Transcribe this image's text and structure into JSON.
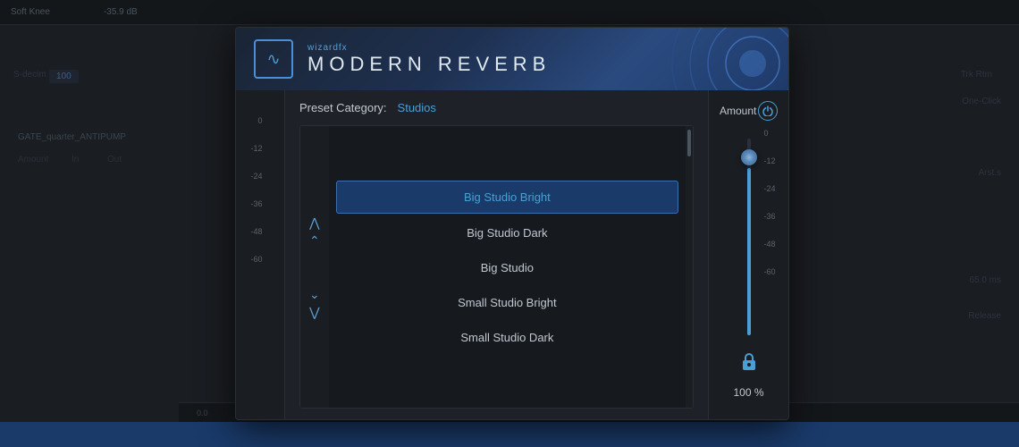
{
  "header": {
    "brand": "wizardFX",
    "product": "MODERN  REVERB",
    "logo_symbol": "∿"
  },
  "preset": {
    "category_label": "Preset Category:",
    "category_value": "Studios"
  },
  "preset_list": {
    "items": [
      {
        "id": "big-studio-bright",
        "label": "Big Studio Bright",
        "selected": true
      },
      {
        "id": "big-studio-dark",
        "label": "Big Studio Dark",
        "selected": false
      },
      {
        "id": "big-studio",
        "label": "Big Studio",
        "selected": false
      },
      {
        "id": "small-studio-bright",
        "label": "Small Studio Bright",
        "selected": false
      },
      {
        "id": "small-studio-dark",
        "label": "Small Studio Dark",
        "selected": false
      }
    ]
  },
  "amount": {
    "label": "Amount",
    "value": "100 %",
    "slider_position_pct": 15
  },
  "vu_scale": {
    "left_ticks": [
      "0",
      "-12",
      "-24",
      "-36",
      "-48",
      "-60"
    ],
    "right_ticks": [
      "0",
      "-12",
      "-24",
      "-36",
      "-48",
      "-60"
    ]
  },
  "nav_buttons": {
    "up_double": "«",
    "up_single": "‹",
    "down_single": "›",
    "down_double": "»"
  },
  "bg_labels": {
    "soft_knee": "Soft Knee",
    "gate_preset": "GATE_quarter_ANTIPUMP",
    "amount_label": "Amount",
    "in_label": "In",
    "out_label": "Out"
  },
  "colors": {
    "accent_blue": "#4a9fd4",
    "dark_bg": "#1e2228",
    "panel_bg": "#1a1d22",
    "selected_bg": "#1a3a6a",
    "selected_border": "#3a70b0",
    "text_primary": "#c0c8d0",
    "text_muted": "#6a7580"
  }
}
